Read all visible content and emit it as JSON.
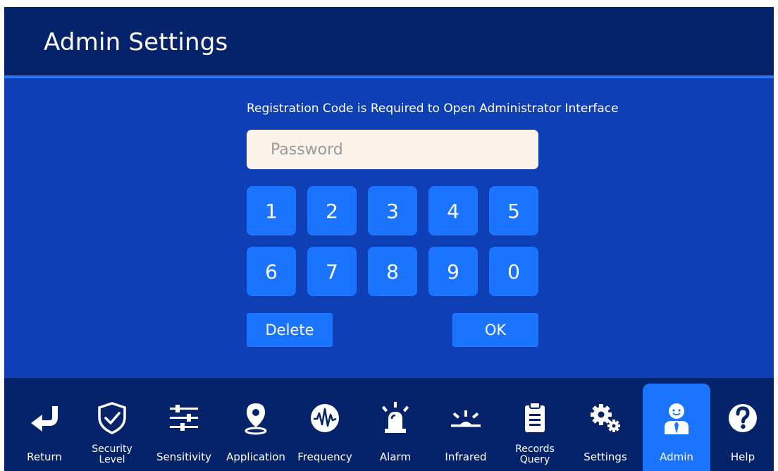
{
  "header": {
    "title": "Admin Settings"
  },
  "main": {
    "prompt": "Registration Code is Required to Open Administrator Interface",
    "password": {
      "value": "",
      "placeholder": "Password"
    },
    "keypad": [
      "1",
      "2",
      "3",
      "4",
      "5",
      "6",
      "7",
      "8",
      "9",
      "0"
    ],
    "delete_label": "Delete",
    "ok_label": "OK"
  },
  "nav": {
    "active": "Admin",
    "items": [
      {
        "line1": "Return",
        "line2": "",
        "icon": "return-arrow-icon"
      },
      {
        "line1": "Security",
        "line2": "Level",
        "icon": "shield-check-icon"
      },
      {
        "line1": "Sensitivity",
        "line2": "",
        "icon": "sliders-icon"
      },
      {
        "line1": "Application",
        "line2": "",
        "icon": "location-pin-icon"
      },
      {
        "line1": "Frequency",
        "line2": "",
        "icon": "waveform-icon"
      },
      {
        "line1": "Alarm",
        "line2": "",
        "icon": "alarm-siren-icon"
      },
      {
        "line1": "Infrared",
        "line2": "",
        "icon": "infrared-sensor-icon"
      },
      {
        "line1": "Records",
        "line2": "Query",
        "icon": "clipboard-icon"
      },
      {
        "line1": "Settings",
        "line2": "",
        "icon": "gears-icon"
      },
      {
        "line1": "Admin",
        "line2": "",
        "icon": "admin-person-icon"
      },
      {
        "line1": "Help",
        "line2": "",
        "icon": "help-question-icon"
      }
    ]
  },
  "colors": {
    "header_bg": "#05236a",
    "content_bg": "#0f3fb4",
    "accent": "#1a74ff",
    "field_bg": "#fbf3ea"
  }
}
